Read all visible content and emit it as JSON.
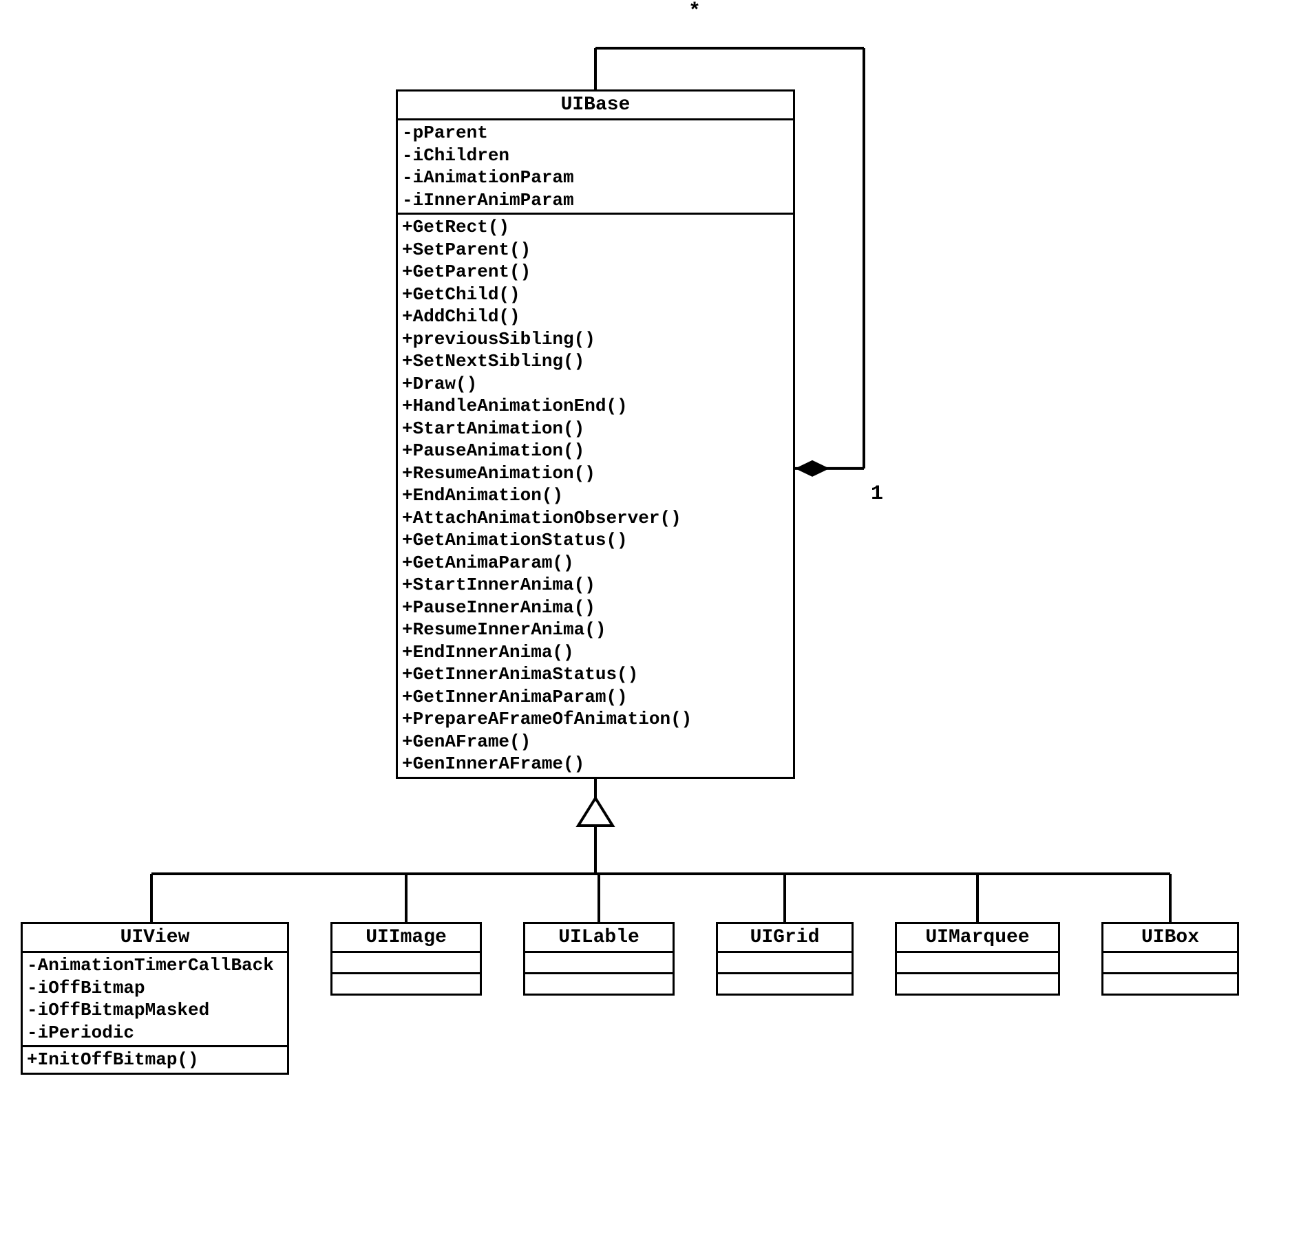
{
  "multiplicity": {
    "many": "*",
    "one": "1"
  },
  "base": {
    "name": "UIBase",
    "attrs": [
      "-pParent",
      "-iChildren",
      "-iAnimationParam",
      "-iInnerAnimParam"
    ],
    "ops": [
      "+GetRect()",
      "+SetParent()",
      "+GetParent()",
      "+GetChild()",
      "+AddChild()",
      "+previousSibling()",
      "+SetNextSibling()",
      "+Draw()",
      "+HandleAnimationEnd()",
      "+StartAnimation()",
      "+PauseAnimation()",
      "+ResumeAnimation()",
      "+EndAnimation()",
      "+AttachAnimationObserver()",
      "+GetAnimationStatus()",
      "+GetAnimaParam()",
      "+StartInnerAnima()",
      "+PauseInnerAnima()",
      "+ResumeInnerAnima()",
      "+EndInnerAnima()",
      "+GetInnerAnimaStatus()",
      "+GetInnerAnimaParam()",
      "+PrepareAFrameOfAnimation()",
      "+GenAFrame()",
      "+GenInnerAFrame()"
    ]
  },
  "view": {
    "name": "UIView",
    "attrs": [
      "-AnimationTimerCallBack",
      "-iOffBitmap",
      "-iOffBitmapMasked",
      "-iPeriodic"
    ],
    "ops": [
      "+InitOffBitmap()"
    ]
  },
  "image": {
    "name": "UIImage"
  },
  "lable": {
    "name": "UILable"
  },
  "grid": {
    "name": "UIGrid"
  },
  "marquee": {
    "name": "UIMarquee"
  },
  "box": {
    "name": "UIBox"
  }
}
